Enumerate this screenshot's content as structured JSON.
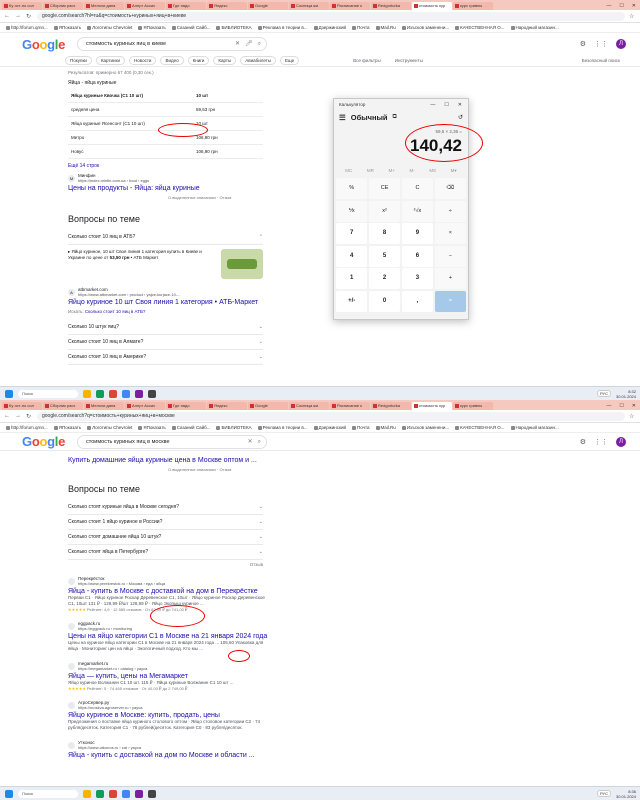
{
  "screenshot1": {
    "tabs": [
      "Ку ост-но сол",
      "Сборник расх",
      "Мелочи дана",
      "Алерт Ассис",
      "Где надо",
      "Яндекс",
      "Google",
      "Сосница жи",
      "Расписание к",
      "Redgortorka",
      "стоимость кур",
      "курс гривны"
    ],
    "window_controls": [
      "—",
      "☐",
      "✕"
    ],
    "url": "google.com/search?hl=ru&q=стоимость+куриных+яиц+в+киеве",
    "bookmarks": [
      "http://forum.qrnn...",
      "ЯПоказать",
      "Логотипы Chevrolet",
      "ЯПоказать",
      "Сазаний Сайб...",
      "БИБЛИОТЕКА",
      "Реклама в теории в...",
      "Дзержинский",
      "Почта",
      "Mail.Ru",
      "Изъсков заменени...",
      "КАЧЕСТВЕННАЯ О...",
      "Народный магазин..."
    ],
    "search_query": "стоимость куриных яиц в киеве",
    "google_tabs": [
      "Покупки",
      "Картинки",
      "Новости",
      "Видео",
      "Книги",
      "Карты",
      "Авиабилеты",
      "Еще"
    ],
    "tools": [
      "Все фильтры",
      "Инструменты"
    ],
    "safe_search": "Безопасный поиск",
    "results_count": "Результатов: примерно 67 400 (0,30 сек.)",
    "snippet_title": "Яйца - яйца куриные",
    "table": [
      {
        "label": "Яйца куриные Квочка (С1 10 шт)",
        "value": "10 шт"
      },
      {
        "label": "средняя цена",
        "value": "59,53 грн"
      },
      {
        "label": "Яйца куриные Ясенсонт (С1 10 шт)",
        "value": "10 шт"
      },
      {
        "label": "Метро",
        "value": "106,90 грн"
      },
      {
        "label": "Новус",
        "value": "106,90 грн"
      }
    ],
    "more_link": "Ещё 14 строк",
    "src1_name": "Минфин",
    "src1_url": "https://index.minfin.com.ua › food › eggs",
    "src1_title": "Цены на продукты - Яйца: яйца куриные",
    "about": "О выделенных описаниях · Отзыв",
    "paa_title": "Вопросы по теме",
    "q1": "Сколько стоит 10 яиц в АТБ?",
    "a1_text_pre": "Яйцо куриное, 10 шт Своя линия 1 категория купить в Киеве и Украине по цене от ",
    "a1_price": "53,50 грн",
    "a1_text_post": " • АТБ Маркет",
    "src2_name": "atbmarket.com",
    "src2_url": "https://www.atbmarket.com › product › yajce-kurjace-10-...",
    "src2_title": "Яйцо куриное 10 шт Своя линия 1 категория • АТБ-Маркет",
    "search_more_pre": "Искать: ",
    "search_more_link": "Сколько стоит 10 яиц в АТБ?",
    "questions": [
      "Сколько 10 штук яиц?",
      "Сколько стоит 10 яиц в Алмате?",
      "Сколько стоит 10 яиц в Америке?"
    ],
    "calc": {
      "app_name": "Калькулятор",
      "mode": "Обычный",
      "expression": "59,5 × 2,36 =",
      "result": "140,42",
      "memory": [
        "MC",
        "MR",
        "M+",
        "M-",
        "MS",
        "M▾"
      ],
      "keys": [
        "%",
        "CE",
        "C",
        "⌫",
        "⅟x",
        "x²",
        "²√x",
        "÷",
        "7",
        "8",
        "9",
        "×",
        "4",
        "5",
        "6",
        "−",
        "1",
        "2",
        "3",
        "+",
        "+/-",
        "0",
        ",",
        "="
      ]
    },
    "taskbar": {
      "search": "Поиск",
      "time": "8:32",
      "date": "30.01.2024",
      "lang": "РУС"
    }
  },
  "screenshot2": {
    "url": "google.com/search?q=стоимость+куриных+яиц+в+москве",
    "search_query": "стоимость куриных яиц в москве",
    "top_result_title": "Купить домашние яйца куриные цена в Москве оптом и ...",
    "about": "О выделенных описаниях · Отзыв",
    "paa_title": "Вопросы по теме",
    "questions": [
      "Сколько стоят куриные яйца в Москве сегодня?",
      "Сколько стоит 1 яйцо куриное в России?",
      "Сколько стоят домашние яйца 10 штук?",
      "Сколько стоят яйца в Петербурге?"
    ],
    "feedback": "Отзыв",
    "results": [
      {
        "name": "Перекрёсток",
        "url": "https://www.perekrestok.ru › Москва › еда › яйца",
        "title": "Яйца - купить в Москве с доставкой на дом в Перекрёстке",
        "snippet": "Перваи С1 · Яйцо куриное Роскар Деревенское С1, 10шт · Яйцо куриное Роскар Деревенское С1, 10шт 131 ₽ · 129,99 ₽/шт 128,99 ₽ · Яйцо Экопыш куриное ...",
        "rating": "Рейтинг: 4,9 · 12 585 отзывов · От 82,99 ₽ до 741,00 ₽"
      },
      {
        "name": "eggpack.ru",
        "url": "https://eggpack.ru › monitoring",
        "title": "Цены на яйцо категории С1 в Москве на 21 января 2024 года",
        "snippet": "Цены на куриное яйцо категории С1 в Москве на 21 января 2024 года ... 105,60 Упаковка для яйца · Мониторинг цен на яйцо · Экологичный подход. Кто мы ...",
        "rating": ""
      },
      {
        "name": "megamarket.ru",
        "url": "https://megamarket.ru › catalog › yayca",
        "title": "Яйца — купить, цены на Мегамаркет",
        "snippet": "Яйцо куриное Волжанин С1 10 шт. 115 ₽ · Яйца куриные Волжанин С1 10 шт ...",
        "rating": "Рейтинг: 5 · 74 465 отзывов · От 40,00 ₽ до 2 749,00 ₽"
      },
      {
        "name": "АгроСервер.ру",
        "url": "https://moskva.agroserver.ru › yayca",
        "title": "Яйцо куриное в Москве: купить, продать, цены",
        "snippet": "Предложения о поставке яйца куриного столового оптом · Яйцо столовое категории С2 · 74 рубля/десяток. Категория С1 · 78 рублей/десяток. Категория С0 · 83 рубля/десяток.",
        "rating": ""
      },
      {
        "name": "Утконос",
        "url": "https://www.utkonos.ru › cat › yayca",
        "title": "Яйца - купить с доставкой на дом по Москве и области ...",
        "snippet": "",
        "rating": ""
      }
    ],
    "taskbar": {
      "search": "Поиск",
      "time": "8:36",
      "date": "30.01.2024",
      "lang": "РУС"
    }
  },
  "colors": {
    "link": "#1a0dab",
    "annotation": "#e00000",
    "calc_equals": "#a6c8ea",
    "tabbar": "#f6c9c0"
  }
}
